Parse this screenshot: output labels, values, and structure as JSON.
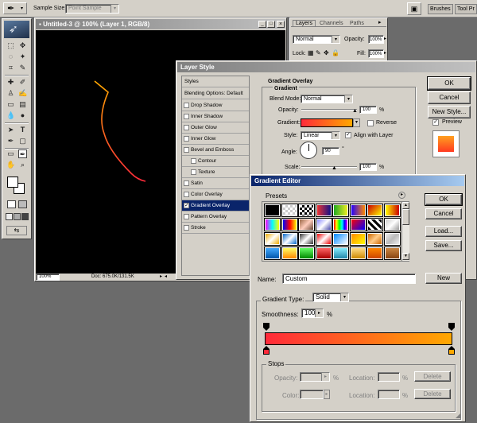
{
  "options_bar": {
    "sample_size_label": "Sample Size:",
    "sample_size_value": "Point Sample",
    "tab_brushes": "Brushes",
    "tab_tool_presets": "Tool Pr"
  },
  "document": {
    "title": "Untitled-3 @ 100% (Layer 1, RGB/8)",
    "zoom": "100%",
    "doc_info": "Doc: 675.0K/131.5K"
  },
  "layers_panel": {
    "tabs": [
      "Layers",
      "Channels",
      "Paths"
    ],
    "blend_mode": "Normal",
    "opacity_label": "Opacity:",
    "opacity_value": "100%",
    "lock_label": "Lock:",
    "fill_label": "Fill:",
    "fill_value": "100%"
  },
  "layer_style": {
    "title": "Layer Style",
    "styles_header": "Styles",
    "blending_options": "Blending Options: Default",
    "effects": [
      {
        "label": "Drop Shadow",
        "checked": false,
        "indent": false
      },
      {
        "label": "Inner Shadow",
        "checked": false,
        "indent": false
      },
      {
        "label": "Outer Glow",
        "checked": false,
        "indent": false
      },
      {
        "label": "Inner Glow",
        "checked": false,
        "indent": false
      },
      {
        "label": "Bevel and Emboss",
        "checked": false,
        "indent": false
      },
      {
        "label": "Contour",
        "checked": false,
        "indent": true
      },
      {
        "label": "Texture",
        "checked": false,
        "indent": true
      },
      {
        "label": "Satin",
        "checked": false,
        "indent": false
      },
      {
        "label": "Color Overlay",
        "checked": false,
        "indent": false
      },
      {
        "label": "Gradient Overlay",
        "checked": true,
        "indent": false,
        "selected": true
      },
      {
        "label": "Pattern Overlay",
        "checked": false,
        "indent": false
      },
      {
        "label": "Stroke",
        "checked": false,
        "indent": false
      }
    ],
    "section_title": "Gradient Overlay",
    "sub_title": "Gradient",
    "blend_mode_label": "Blend Mode:",
    "blend_mode_value": "Normal",
    "opacity_label": "Opacity:",
    "opacity_value": "100",
    "gradient_label": "Gradient:",
    "reverse_label": "Reverse",
    "style_label": "Style:",
    "style_value": "Linear",
    "align_label": "Align with Layer",
    "angle_label": "Angle:",
    "angle_value": "90",
    "scale_label": "Scale:",
    "scale_value": "100",
    "percent": "%",
    "degree": "°",
    "ok": "OK",
    "cancel": "Cancel",
    "new_style": "New Style...",
    "preview": "Preview"
  },
  "gradient_editor": {
    "title": "Gradient Editor",
    "presets_label": "Presets",
    "ok": "OK",
    "cancel": "Cancel",
    "load": "Load...",
    "save": "Save...",
    "name_label": "Name:",
    "name_value": "Custom",
    "new_button": "New",
    "gradient_type_label": "Gradient Type:",
    "gradient_type_value": "Solid",
    "smoothness_label": "Smoothness:",
    "smoothness_value": "100",
    "percent": "%",
    "stops_label": "Stops",
    "stop_opacity_label": "Opacity:",
    "stop_location_label": "Location:",
    "stop_color_label": "Color:",
    "delete_label": "Delete",
    "start_color": "#ff2a3a",
    "end_color": "#ffa800"
  }
}
